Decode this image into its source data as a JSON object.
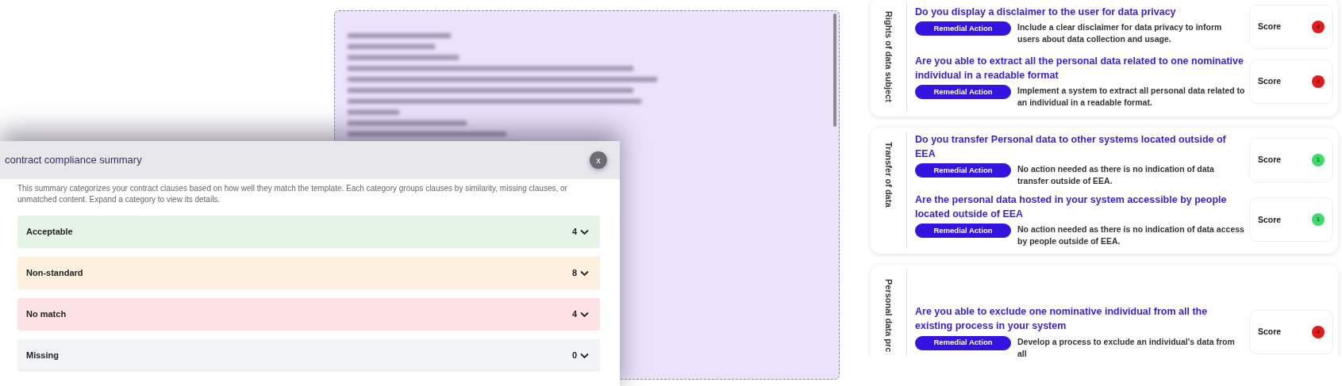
{
  "modal": {
    "title": "contract compliance summary",
    "close": "x",
    "description": "This summary categorizes your contract clauses based on how well they match the template. Each category groups clauses by similarity, missing clauses, or unmatched content. Expand a category to view its details.",
    "categories": [
      {
        "label": "Acceptable",
        "count": "4",
        "color": "#e6f4e8"
      },
      {
        "label": "Non-standard",
        "count": "8",
        "color": "#fdf0df"
      },
      {
        "label": "No match",
        "count": "4",
        "color": "#fde2e5"
      },
      {
        "label": "Missing",
        "count": "0",
        "color": "#f2f3f4"
      }
    ]
  },
  "assessment": {
    "sections": [
      {
        "label": "Rights of data subject",
        "questions": [
          {
            "question": "Do you display a disclaimer to the user for data privacy",
            "action_label": "Remedial Action",
            "action": "Include a clear disclaimer for data privacy to inform users about data collection and usage.",
            "score_label": "Score",
            "score": "4",
            "color": "#e01b1b"
          },
          {
            "question": "Are you able to extract all the personal data related to one nominative individual in a readable format",
            "action_label": "Remedial Action",
            "action": "Implement a system to extract all personal data related to an individual in a readable format.",
            "score_label": "Score",
            "score": "4",
            "color": "#e01b1b"
          }
        ]
      },
      {
        "label": "Transfer of data",
        "questions": [
          {
            "question": "Do you transfer Personal data to other systems located outside of EEA",
            "action_label": "Remedial Action",
            "action": "No action needed as there is no indication of data transfer outside of EEA.",
            "score_label": "Score",
            "score": "1",
            "color": "#3ddc6a"
          },
          {
            "question": "Are the personal data hosted in your system accessible by people located outside of EEA",
            "action_label": "Remedial Action",
            "action": "No action needed as there is no indication of data access by people outside of EEA.",
            "score_label": "Score",
            "score": "1",
            "color": "#3ddc6a"
          }
        ]
      },
      {
        "label": "Personal data prc",
        "questions": [
          {
            "question": "Are you able to exclude one nominative individual from all the existing process in your system",
            "action_label": "Remedial Action",
            "action": "Develop a process to exclude an individual's data from all",
            "score_label": "Score",
            "score": "4",
            "color": "#e01b1b"
          }
        ]
      }
    ]
  }
}
